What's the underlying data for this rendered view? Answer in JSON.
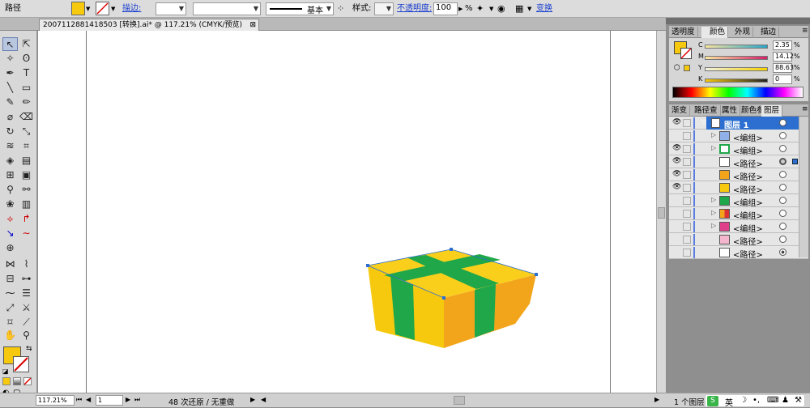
{
  "control_bar": {
    "object_type": "路径",
    "stroke_label": "描边:",
    "stroke_style": "基本",
    "style_label": "样式:",
    "opacity_label": "不透明度:",
    "opacity_value": "100",
    "opacity_unit": "%",
    "transform_label": "变换"
  },
  "document": {
    "tab_title": "2007112881418503 [转换].ai* @ 117.21% (CMYK/预览)"
  },
  "status_bar": {
    "zoom": "117.21%",
    "artboard_number": "1",
    "history_text": "48 次还原 / 无重做"
  },
  "color_panel": {
    "tabs": [
      "透明度",
      "颜色",
      "外观",
      "描边"
    ],
    "active_tab": "颜色",
    "fill_color": "#f6c90e",
    "sliders": [
      {
        "label": "C",
        "value": "2.35"
      },
      {
        "label": "M",
        "value": "14.12"
      },
      {
        "label": "Y",
        "value": "88.63"
      },
      {
        "label": "K",
        "value": "0"
      }
    ],
    "unit": "%"
  },
  "layers_panel": {
    "tabs": [
      "渐变",
      "路径查",
      "属性",
      "颜色参",
      "图层"
    ],
    "active_tab": "图层",
    "rows": [
      {
        "name": "图层 1",
        "eye": true,
        "expandable": false
      },
      {
        "name": "<编组>",
        "eye": false,
        "expandable": true
      },
      {
        "name": "<编组>",
        "eye": true,
        "expandable": true
      },
      {
        "name": "<路径>",
        "eye": true,
        "expandable": false
      },
      {
        "name": "<路径>",
        "eye": true,
        "expandable": false
      },
      {
        "name": "<路径>",
        "eye": true,
        "expandable": false
      },
      {
        "name": "<编组>",
        "eye": false,
        "expandable": true
      },
      {
        "name": "<编组>",
        "eye": false,
        "expandable": true
      },
      {
        "name": "<编组>",
        "eye": false,
        "expandable": true
      },
      {
        "name": "<路径>",
        "eye": false,
        "expandable": false
      },
      {
        "name": "<路径>",
        "eye": false,
        "expandable": false
      }
    ],
    "footer": "1 个图层"
  },
  "ime": {
    "label": "英"
  },
  "colors": {
    "box_yellow": "#f6c90e",
    "box_orange": "#f2a51b",
    "ribbon_green": "#1fa74a",
    "selection_blue": "#2c6fd0"
  }
}
